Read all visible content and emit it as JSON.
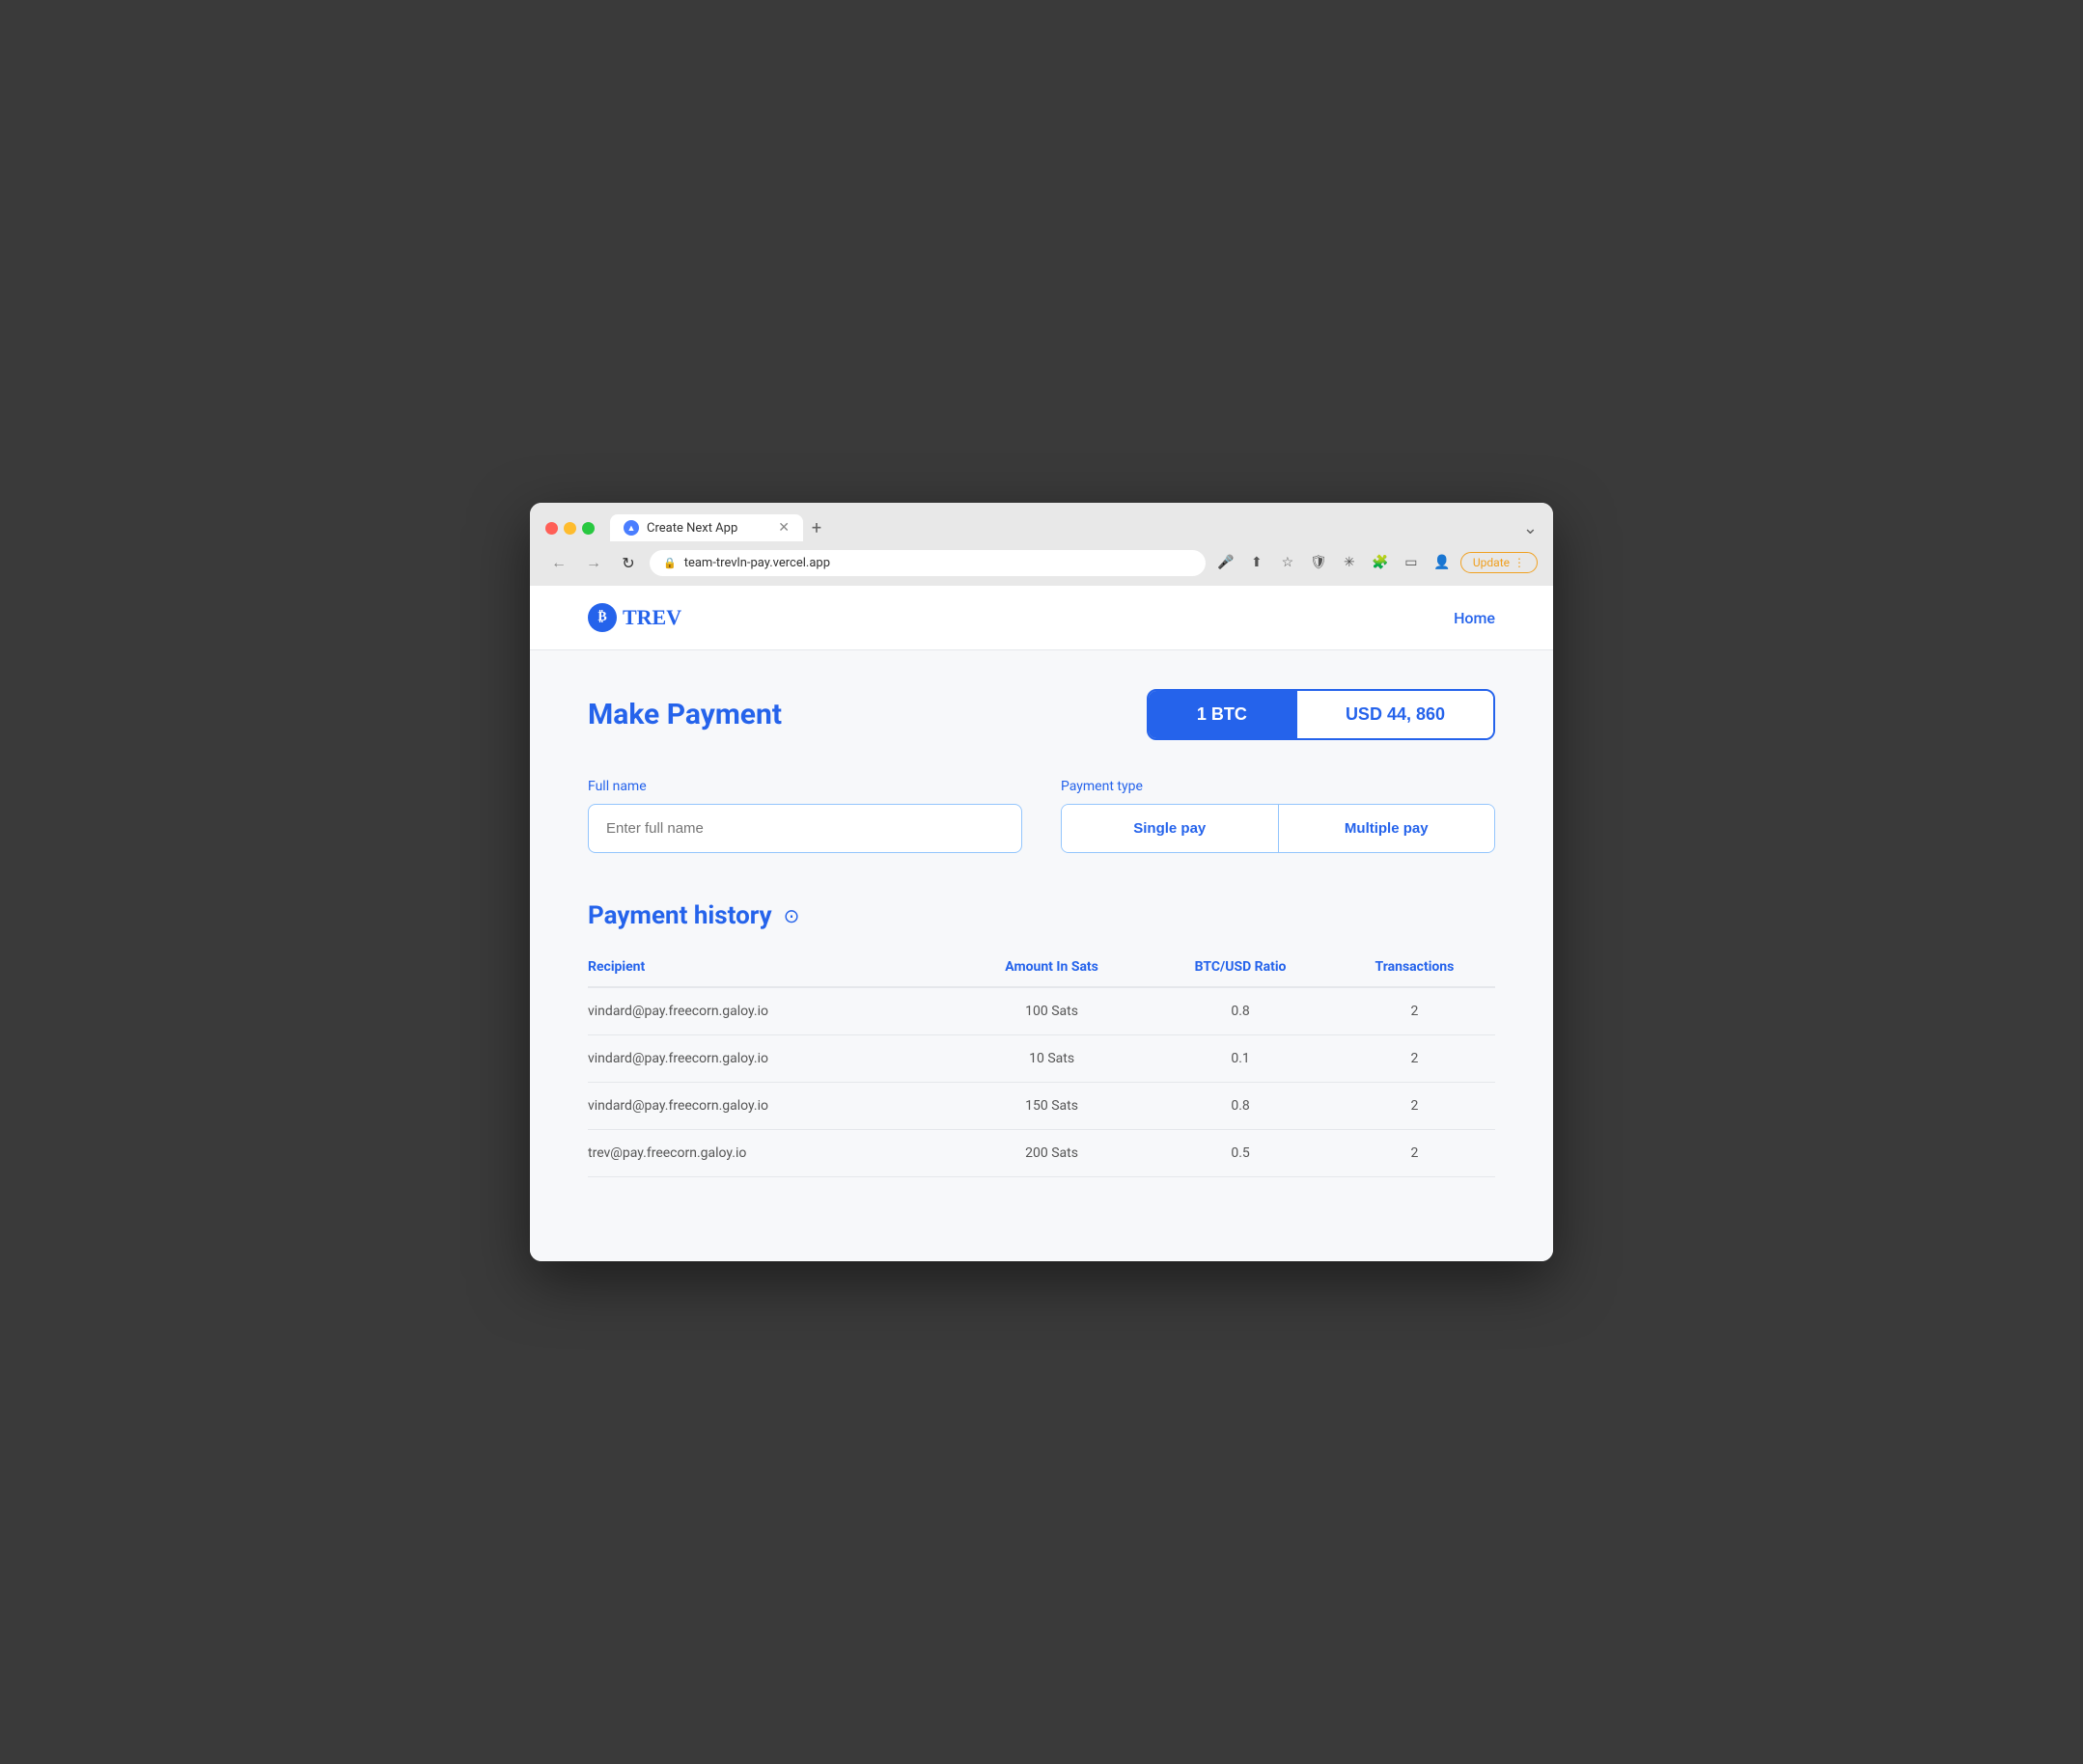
{
  "browser": {
    "tab_title": "Create Next App",
    "url": "team-trevln-pay.vercel.app",
    "new_tab_label": "+",
    "nav_back": "←",
    "nav_forward": "→",
    "nav_refresh": "↻",
    "update_btn": "Update",
    "menu_label": "⌄"
  },
  "nav": {
    "logo_text": "TREV",
    "home_label": "Home"
  },
  "payment": {
    "title": "Make Payment",
    "currency_btc": "1 BTC",
    "currency_usd": "USD 44, 860",
    "full_name_label": "Full name",
    "full_name_placeholder": "Enter full name",
    "payment_type_label": "Payment type",
    "single_pay": "Single pay",
    "multiple_pay": "Multiple pay"
  },
  "history": {
    "title": "Payment history",
    "columns": [
      "Recipient",
      "Amount In Sats",
      "BTC/USD Ratio",
      "Transactions"
    ],
    "rows": [
      {
        "recipient": "vindard@pay.freecorn.galoy.io",
        "amount": "100 Sats",
        "ratio": "0.8",
        "transactions": "2"
      },
      {
        "recipient": "vindard@pay.freecorn.galoy.io",
        "amount": "10 Sats",
        "ratio": "0.1",
        "transactions": "2"
      },
      {
        "recipient": "vindard@pay.freecorn.galoy.io",
        "amount": "150 Sats",
        "ratio": "0.8",
        "transactions": "2"
      },
      {
        "recipient": "trev@pay.freecorn.galoy.io",
        "amount": "200 Sats",
        "ratio": "0.5",
        "transactions": "2"
      }
    ]
  }
}
